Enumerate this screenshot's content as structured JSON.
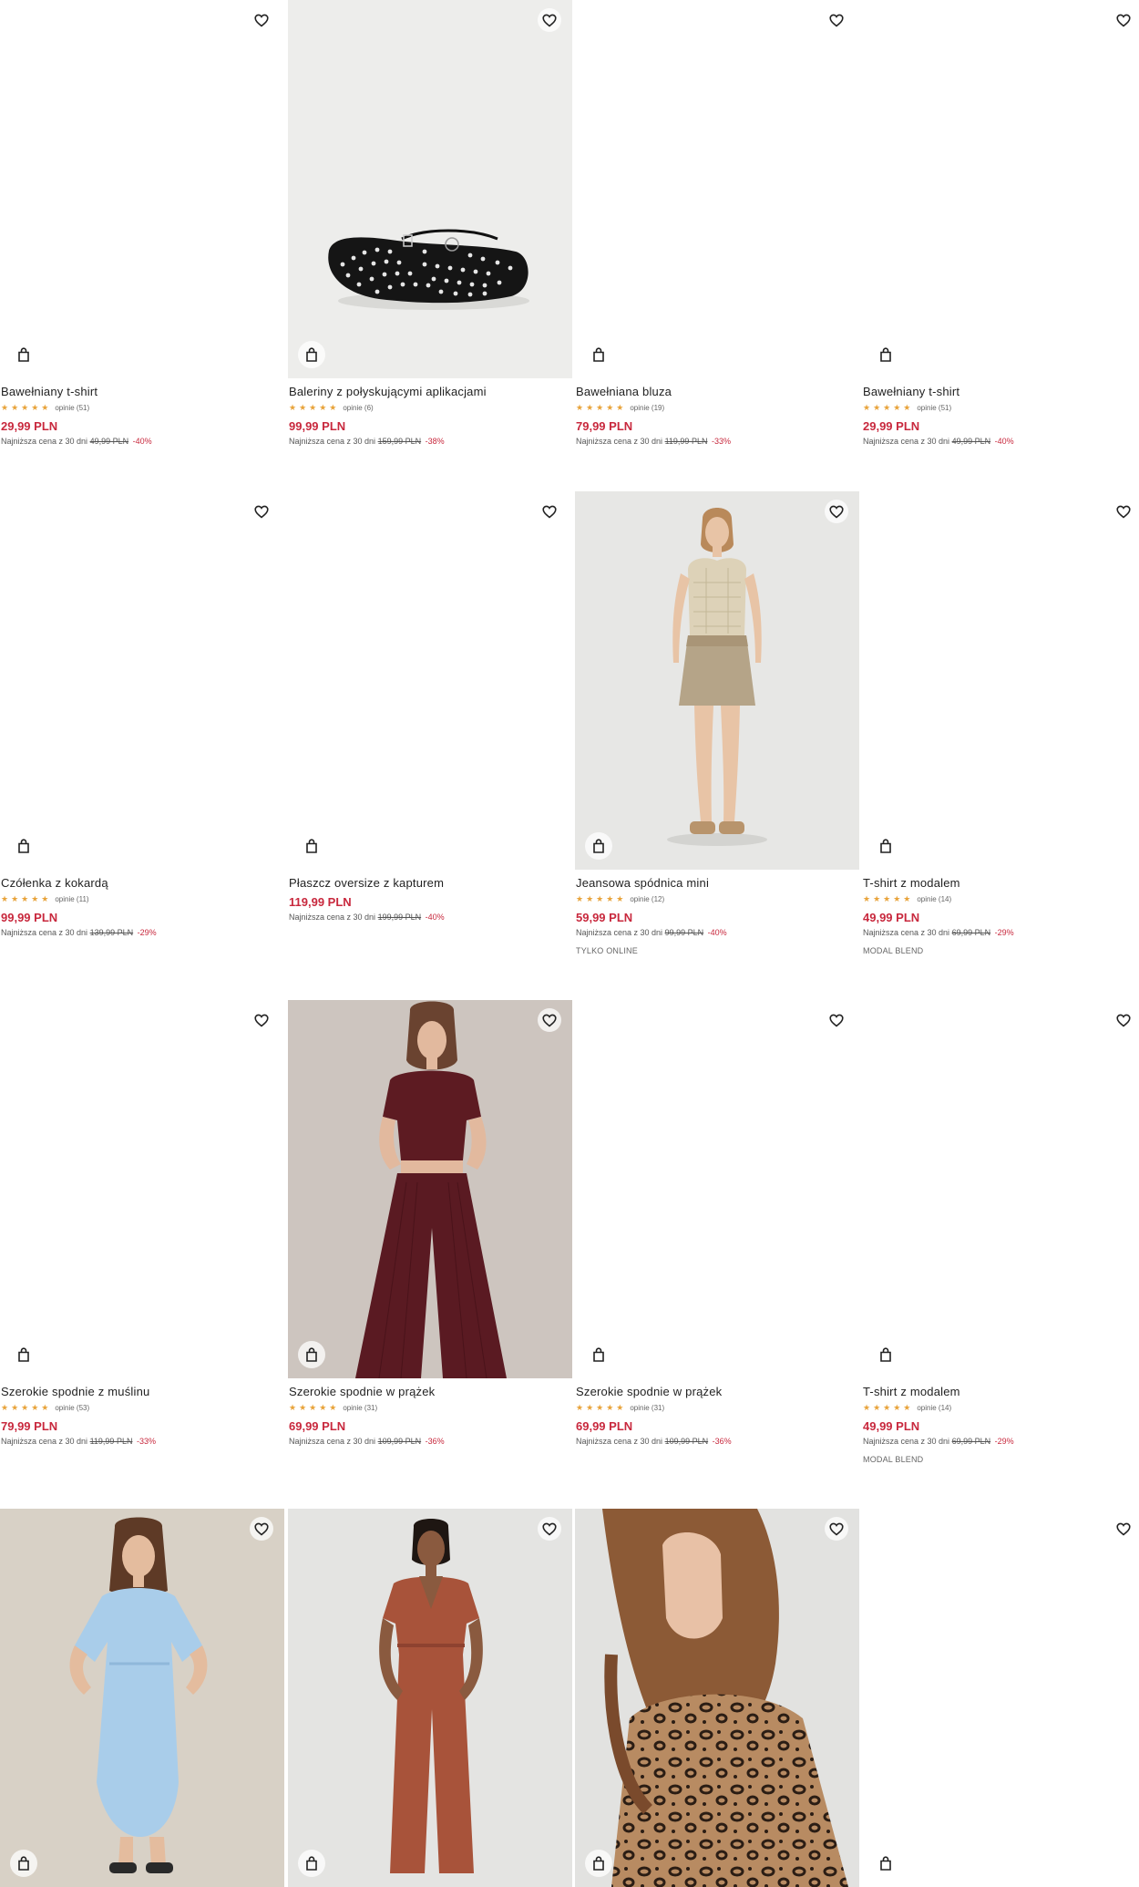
{
  "colors": {
    "price": "#c8283d",
    "stars": "#e8a33a",
    "text": "#222222"
  },
  "icons": {
    "favorite": "heart-outline-icon",
    "cart": "shopping-bag-icon"
  },
  "products": [
    {
      "title": "Bawełniany t-shirt",
      "stars": "★★★★★",
      "reviews": "opinie (51)",
      "price": "29,99 PLN",
      "lowest_label": "Najniższa cena z 30 dni",
      "old_price": "49,99 PLN",
      "discount": "-40%",
      "tag": ""
    },
    {
      "title": "Baleriny z połyskującymi aplikacjami",
      "stars": "★★★★★",
      "reviews": "opinie (6)",
      "price": "99,99 PLN",
      "lowest_label": "Najniższa cena z 30 dni",
      "old_price": "159,99 PLN",
      "discount": "-38%",
      "tag": ""
    },
    {
      "title": "Bawełniana bluza",
      "stars": "★★★★★",
      "reviews": "opinie (19)",
      "price": "79,99 PLN",
      "lowest_label": "Najniższa cena z 30 dni",
      "old_price": "119,99 PLN",
      "discount": "-33%",
      "tag": ""
    },
    {
      "title": "Bawełniany t-shirt",
      "stars": "★★★★★",
      "reviews": "opinie (51)",
      "price": "29,99 PLN",
      "lowest_label": "Najniższa cena z 30 dni",
      "old_price": "49,99 PLN",
      "discount": "-40%",
      "tag": ""
    },
    {
      "title": "Czółenka z kokardą",
      "stars": "★★★★★",
      "reviews": "opinie (11)",
      "price": "99,99 PLN",
      "lowest_label": "Najniższa cena z 30 dni",
      "old_price": "139,99 PLN",
      "discount": "-29%",
      "tag": ""
    },
    {
      "title": "Płaszcz oversize z kapturem",
      "stars": "",
      "reviews": "",
      "price": "119,99 PLN",
      "lowest_label": "Najniższa cena z 30 dni",
      "old_price": "199,99 PLN",
      "discount": "-40%",
      "tag": ""
    },
    {
      "title": "Jeansowa spódnica mini",
      "stars": "★★★★★",
      "reviews": "opinie (12)",
      "price": "59,99 PLN",
      "lowest_label": "Najniższa cena z 30 dni",
      "old_price": "99,99 PLN",
      "discount": "-40%",
      "tag": "TYLKO ONLINE"
    },
    {
      "title": "T-shirt z modalem",
      "stars": "★★★★★",
      "reviews": "opinie (14)",
      "price": "49,99 PLN",
      "lowest_label": "Najniższa cena z 30 dni",
      "old_price": "69,99 PLN",
      "discount": "-29%",
      "tag": "MODAL BLEND"
    },
    {
      "title": "Szerokie spodnie z muślinu",
      "stars": "★★★★★",
      "reviews": "opinie (53)",
      "price": "79,99 PLN",
      "lowest_label": "Najniższa cena z 30 dni",
      "old_price": "119,99 PLN",
      "discount": "-33%",
      "tag": ""
    },
    {
      "title": "Szerokie spodnie w prążek",
      "stars": "★★★★★",
      "reviews": "opinie (31)",
      "price": "69,99 PLN",
      "lowest_label": "Najniższa cena z 30 dni",
      "old_price": "109,99 PLN",
      "discount": "-36%",
      "tag": ""
    },
    {
      "title": "Szerokie spodnie w prążek",
      "stars": "★★★★★",
      "reviews": "opinie (31)",
      "price": "69,99 PLN",
      "lowest_label": "Najniższa cena z 30 dni",
      "old_price": "109,99 PLN",
      "discount": "-36%",
      "tag": ""
    },
    {
      "title": "T-shirt z modalem",
      "stars": "★★★★★",
      "reviews": "opinie (14)",
      "price": "49,99 PLN",
      "lowest_label": "Najniższa cena z 30 dni",
      "old_price": "69,99 PLN",
      "discount": "-29%",
      "tag": "MODAL BLEND"
    },
    {
      "title": "",
      "stars": "",
      "reviews": "",
      "price": "",
      "lowest_label": "",
      "old_price": "",
      "discount": "",
      "tag": ""
    },
    {
      "title": "",
      "stars": "",
      "reviews": "",
      "price": "",
      "lowest_label": "",
      "old_price": "",
      "discount": "",
      "tag": ""
    },
    {
      "title": "",
      "stars": "",
      "reviews": "",
      "price": "",
      "lowest_label": "",
      "old_price": "",
      "discount": "",
      "tag": ""
    },
    {
      "title": "",
      "stars": "",
      "reviews": "",
      "price": "",
      "lowest_label": "",
      "old_price": "",
      "discount": "",
      "tag": ""
    }
  ]
}
